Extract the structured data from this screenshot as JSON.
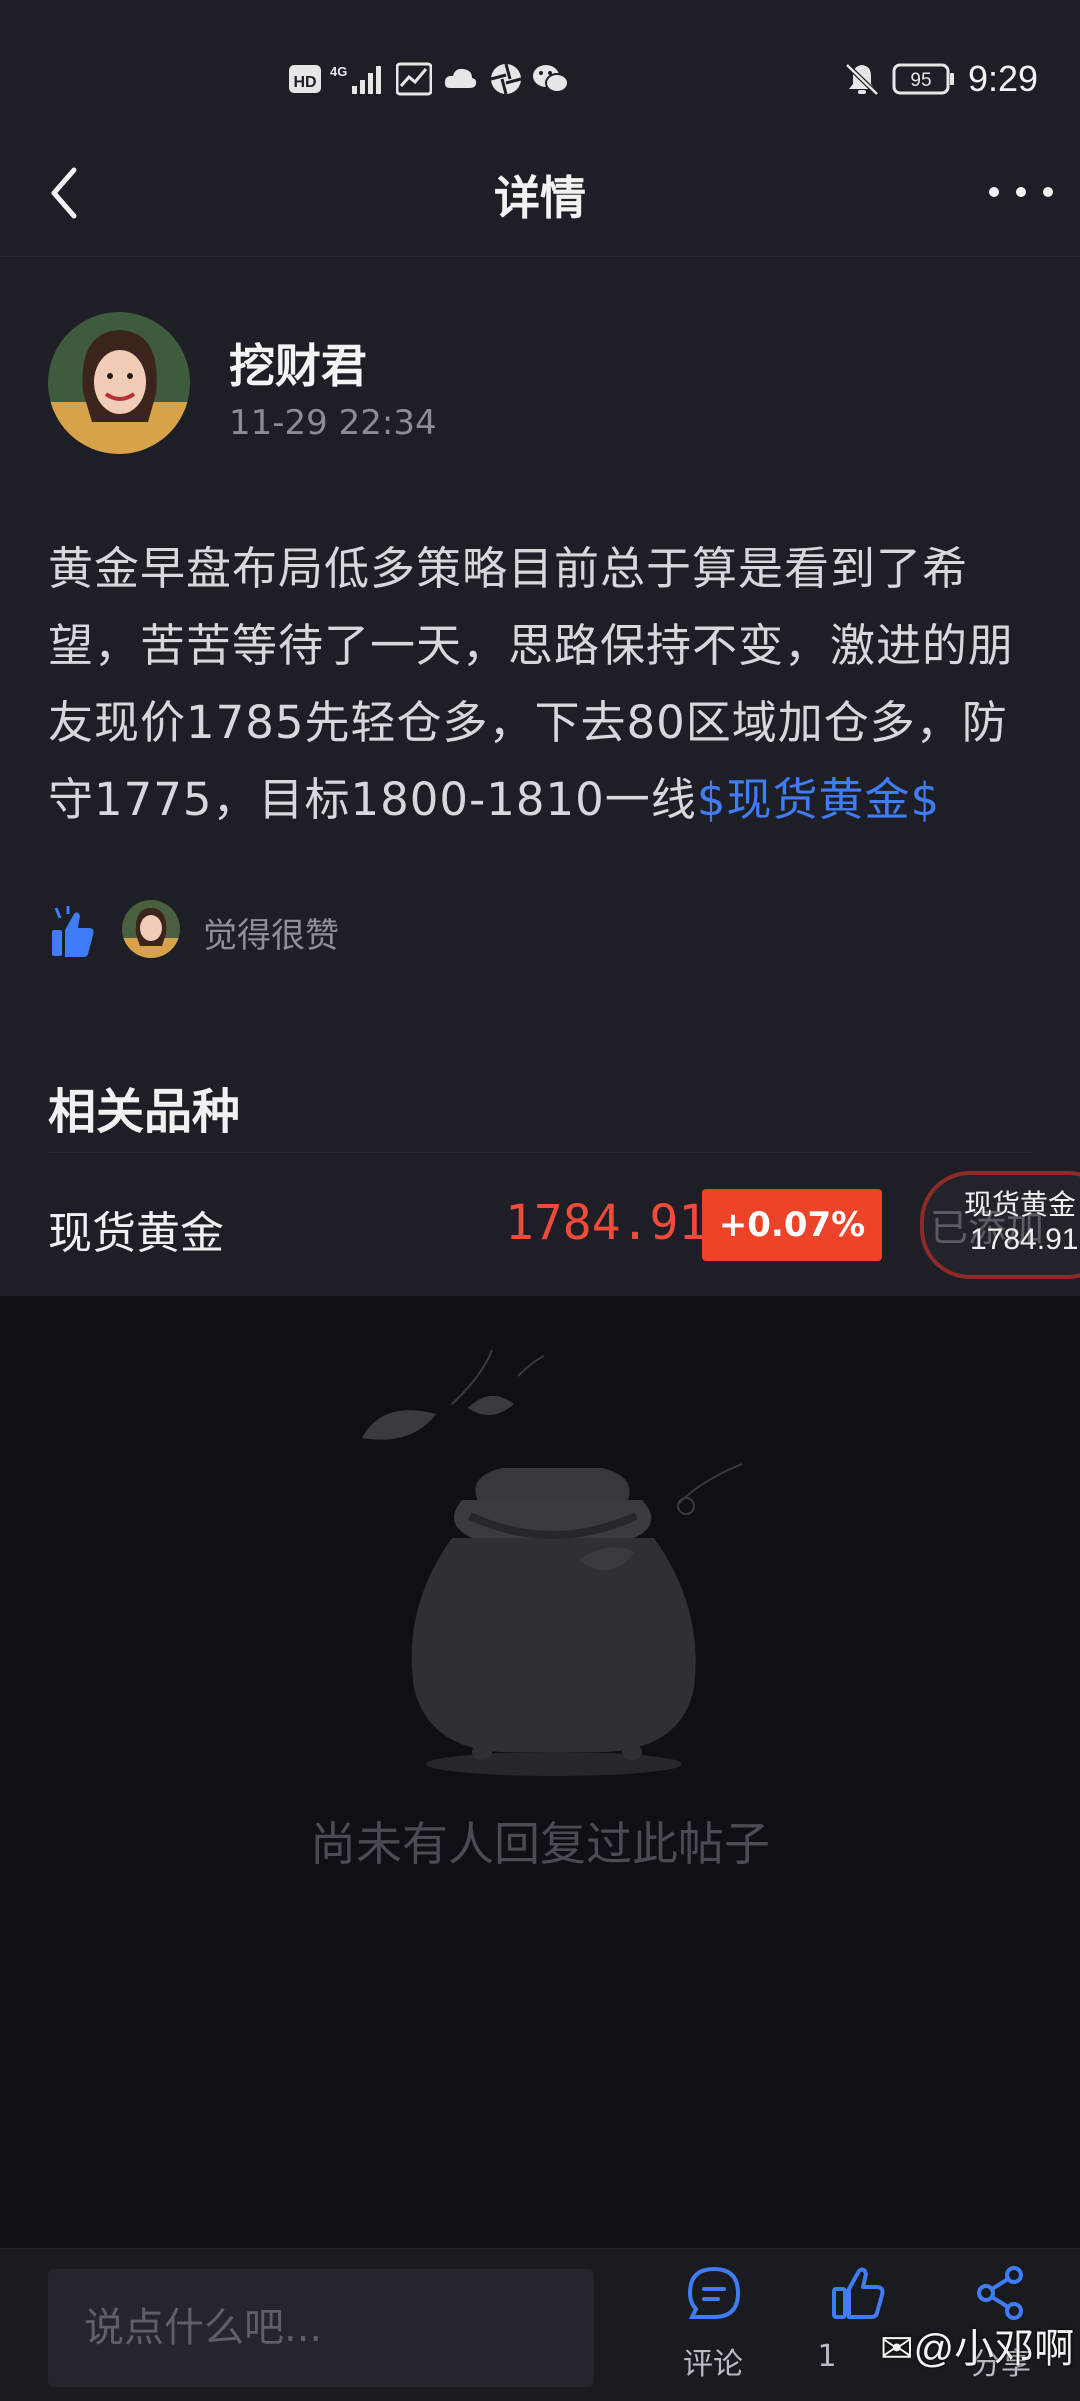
{
  "status_bar": {
    "hd": "HD",
    "network": "4G",
    "battery": "95",
    "time": "9:29"
  },
  "header": {
    "title": "详情"
  },
  "post": {
    "author": "挖财君",
    "timestamp": "11-29 22:34",
    "body": "黄金早盘布局低多策略目前总于算是看到了希望，苦苦等待了一天，思路保持不变，激进的朋友现价1785先轻仓多，下去80区域加仓多，防守1775，目标1800-1810一线",
    "tag": "$现货黄金$",
    "like_text": "觉得很赞"
  },
  "related": {
    "title": "相关品种",
    "name": "现货黄金",
    "price": "1784.91",
    "change": "+0.07%",
    "float_underlying": "已添加",
    "float_name": "现货黄金",
    "float_price": "1784.91"
  },
  "empty": {
    "message": "尚未有人回复过此帖子"
  },
  "bottom_bar": {
    "input_placeholder": "说点什么吧...",
    "comment_label": "评论",
    "like_count": "1",
    "share_label": "分享",
    "watermark": "@小邓啊"
  },
  "colors": {
    "accent_blue": "#3f7cf5",
    "price_red": "#ef4a3a",
    "badge_red": "#ed4328"
  }
}
